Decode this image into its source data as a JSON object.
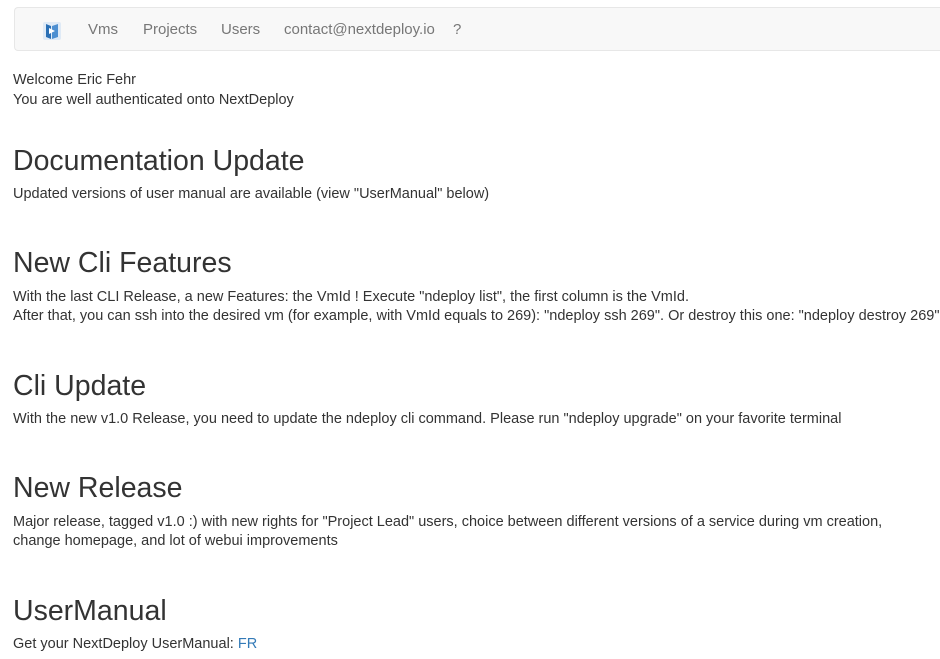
{
  "navbar": {
    "logo_icon": "nextdeploy-logo-icon",
    "items": [
      {
        "label": "Vms"
      },
      {
        "label": "Projects"
      },
      {
        "label": "Users"
      },
      {
        "label": "contact@nextdeploy.io"
      },
      {
        "label": "?"
      }
    ],
    "colors": {
      "background": "#f8f8f8",
      "link": "#777777",
      "brand": "#2a6fb5"
    }
  },
  "welcome": {
    "line1": "Welcome Eric Fehr",
    "line2": "You are well authenticated onto NextDeploy"
  },
  "sections": [
    {
      "title": "Documentation Update",
      "lines": [
        "Updated versions of user manual are available (view \"UserManual\" below)"
      ]
    },
    {
      "title": "New Cli Features",
      "lines": [
        "With the last CLI Release, a new Features: the VmId ! Execute \"ndeploy list\", the first column is the VmId.",
        "After that, you can ssh into the desired vm (for example, with VmId equals to 269): \"ndeploy ssh 269\". Or destroy this one: \"ndeploy destroy 269\""
      ]
    },
    {
      "title": "Cli Update",
      "lines": [
        "With the new v1.0 Release, you need to update the ndeploy cli command. Please run \"ndeploy upgrade\" on your favorite terminal"
      ]
    },
    {
      "title": "New Release",
      "lines": [
        "Major release, tagged v1.0 :) with new rights for \"Project Lead\" users, choice between different versions of a service during vm creation,",
        "change homepage, and lot of webui improvements"
      ]
    },
    {
      "title": "UserManual",
      "text": "Get your NextDeploy UserManual: ",
      "link_label": "FR"
    }
  ],
  "colors": {
    "text": "#333333",
    "link": "#337ab7"
  }
}
